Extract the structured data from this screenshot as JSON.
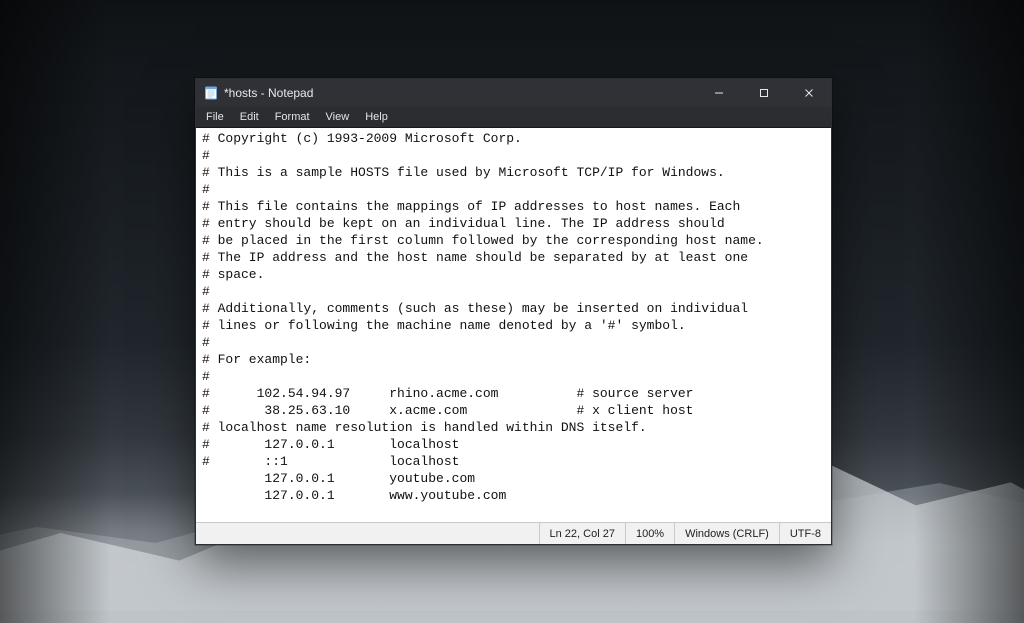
{
  "window": {
    "title": "*hosts - Notepad",
    "icon_name": "notepad-icon"
  },
  "menu": {
    "file": "File",
    "edit": "Edit",
    "format": "Format",
    "view": "View",
    "help": "Help"
  },
  "editor": {
    "content": "# Copyright (c) 1993-2009 Microsoft Corp.\n#\n# This is a sample HOSTS file used by Microsoft TCP/IP for Windows.\n#\n# This file contains the mappings of IP addresses to host names. Each\n# entry should be kept on an individual line. The IP address should\n# be placed in the first column followed by the corresponding host name.\n# The IP address and the host name should be separated by at least one\n# space.\n#\n# Additionally, comments (such as these) may be inserted on individual\n# lines or following the machine name denoted by a '#' symbol.\n#\n# For example:\n#\n#      102.54.94.97     rhino.acme.com          # source server\n#       38.25.63.10     x.acme.com              # x client host\n# localhost name resolution is handled within DNS itself.\n#       127.0.0.1       localhost\n#       ::1             localhost\n        127.0.0.1       youtube.com\n        127.0.0.1       www.youtube.com"
  },
  "status": {
    "position": "Ln 22, Col 27",
    "zoom": "100%",
    "line_ending": "Windows (CRLF)",
    "encoding": "UTF-8"
  }
}
